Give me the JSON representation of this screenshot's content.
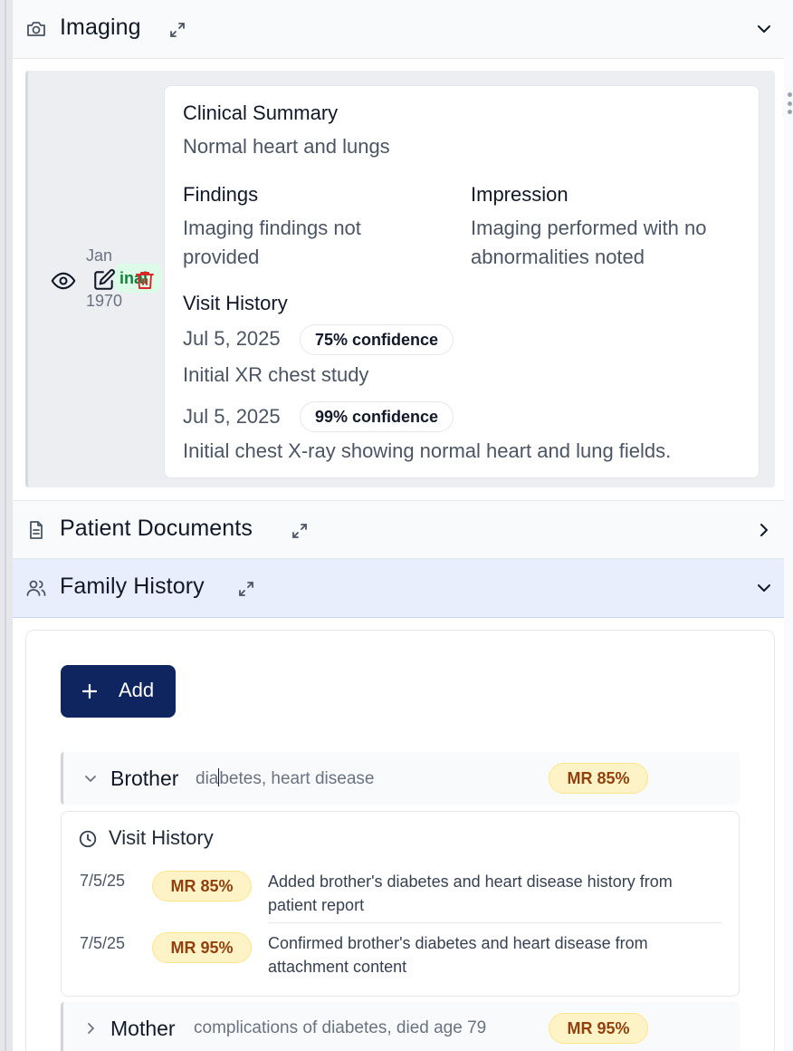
{
  "sections": {
    "imaging": {
      "title": "Imaging",
      "icon": "camera-icon",
      "state": "expanded"
    },
    "patient_documents": {
      "title": "Patient Documents",
      "icon": "document-icon",
      "state": "collapsed"
    },
    "family_history": {
      "title": "Family History",
      "icon": "users-icon",
      "state": "expanded"
    }
  },
  "imaging_record": {
    "date_month": "Jan",
    "date_year": "1970",
    "status": "inal",
    "clinical_summary_label": "Clinical Summary",
    "clinical_summary": "Normal heart and lungs",
    "findings_label": "Findings",
    "findings": "Imaging findings not provided",
    "impression_label": "Impression",
    "impression": "Imaging performed with no abnormalities noted",
    "visit_history_label": "Visit History",
    "visits": [
      {
        "date": "Jul 5, 2025",
        "confidence": "75% confidence",
        "note": "Initial XR chest study"
      },
      {
        "date": "Jul 5, 2025",
        "confidence": "99% confidence",
        "note": "Initial chest X-ray showing normal heart and lung fields."
      }
    ]
  },
  "family_history": {
    "add_label": "Add",
    "members": [
      {
        "relation": "Brother",
        "conditions_before_cursor": "dia",
        "conditions_after_cursor": "betes, heart disease",
        "badge": "MR 85%",
        "expanded": true,
        "visit_history_label": "Visit History",
        "visits": [
          {
            "date": "7/5/25",
            "badge": "MR 85%",
            "note": "Added brother's diabetes and heart disease history from patient report"
          },
          {
            "date": "7/5/25",
            "badge": "MR 95%",
            "note": "Confirmed brother's diabetes and heart disease from attachment content"
          }
        ]
      },
      {
        "relation": "Mother",
        "conditions": "complications of diabetes, died age 79",
        "badge": "MR 95%",
        "expanded": false
      }
    ]
  },
  "colors": {
    "accent": "#0e2560",
    "active_section_bg": "#e8eefc",
    "badge_bg": "#fef3c7",
    "badge_text": "#92400e",
    "status_bg": "#dcfce7",
    "status_text": "#15803d",
    "delete_icon": "#dc2626"
  }
}
